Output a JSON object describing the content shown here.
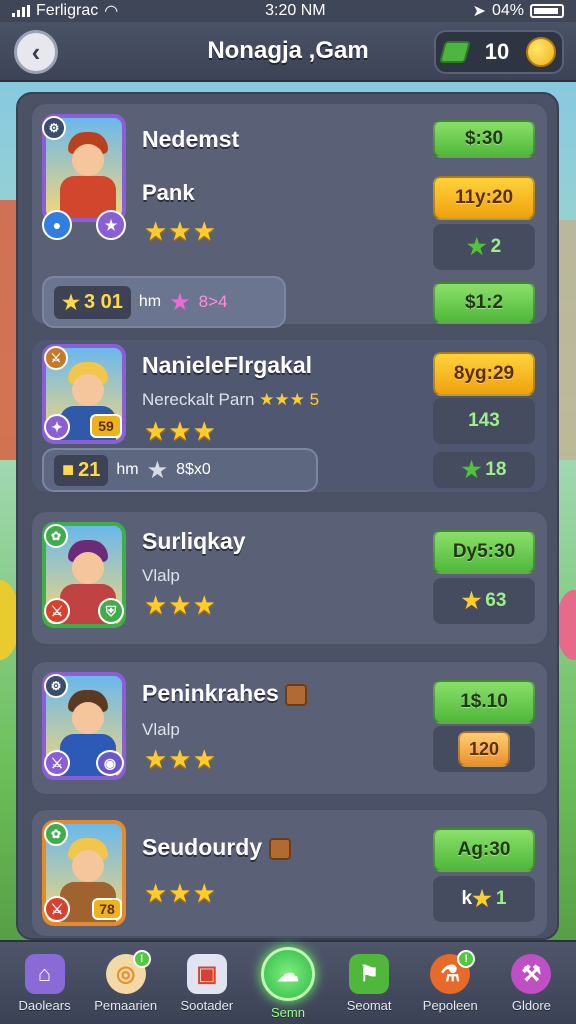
{
  "status_bar": {
    "carrier": "Ferligrac",
    "time": "3:20 NM",
    "battery": "04%"
  },
  "header": {
    "title": "Nonagja ,Gam",
    "back_icon": "back-arrow-icon",
    "currency_count": "10"
  },
  "cards": [
    {
      "title": "Nedemst",
      "name": "Pank",
      "stars": "★★★",
      "price_top": "$:30",
      "price_main": "11y:20",
      "slot_value": "2",
      "tooltip": {
        "chip_value": "3 01",
        "label": "hm",
        "extra": "8>4"
      },
      "bottom_button": "$1:2"
    },
    {
      "name": "NanieleFlrgakal",
      "subtitle": "Nereckalt Parn",
      "subtitle_stars": "★★★",
      "subtitle_value": "5",
      "stars": "★★★",
      "badge_value": "59",
      "price_main": "8yg:29",
      "slot_value": "143",
      "tooltip": {
        "chip_value": "21",
        "label": "hm",
        "extra": "8$x0"
      },
      "bottom_slot_value": "18"
    },
    {
      "name": "Surliqkay",
      "subtitle": "Vlalp",
      "stars": "★★★",
      "price_main": "Dy5:30",
      "slot_value": "63"
    },
    {
      "name": "Peninkrahes",
      "subtitle": "Vlalp",
      "stars": "★★★",
      "price_main": "1$.10",
      "slot_value": "120"
    },
    {
      "name": "Seudourdy",
      "stars": "★★★",
      "badge_value": "78",
      "price_main": "Ag:30",
      "slot_value": "1",
      "slot_prefix": "k"
    }
  ],
  "bottom_nav": [
    {
      "label": "Daolears",
      "icon": "house-icon"
    },
    {
      "label": "Pemaarien",
      "icon": "donut-icon",
      "dot": "!"
    },
    {
      "label": "Sootader",
      "icon": "shop-icon"
    },
    {
      "label": "Semn",
      "icon": "chat-icon",
      "active": true
    },
    {
      "label": "Seomat",
      "icon": "flag-icon"
    },
    {
      "label": "Pepoleen",
      "icon": "potion-icon",
      "dot": "!"
    },
    {
      "label": "Gldore",
      "icon": "tools-icon"
    }
  ]
}
